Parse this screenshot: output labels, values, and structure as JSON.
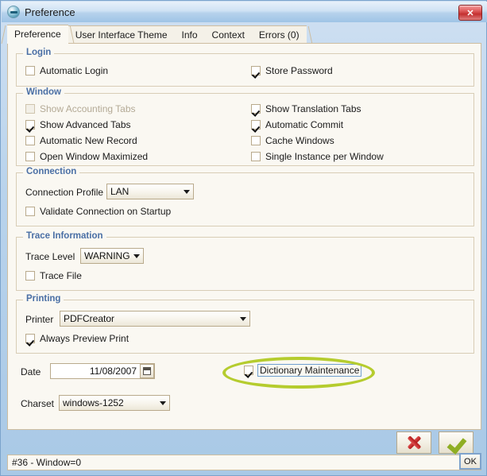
{
  "window": {
    "title": "Preference",
    "icon": "preference-icon",
    "close_label": "✕"
  },
  "tabs": [
    {
      "label": "Preference",
      "active": true
    },
    {
      "label": "User Interface Theme",
      "active": false
    },
    {
      "label": "Info",
      "active": false
    },
    {
      "label": "Context",
      "active": false
    },
    {
      "label": "Errors (0)",
      "active": false
    }
  ],
  "groups": {
    "login": {
      "title": "Login",
      "checkboxes": [
        {
          "label": "Automatic Login",
          "checked": false,
          "disabled": false
        },
        {
          "label": "Store Password",
          "checked": true,
          "disabled": false
        }
      ]
    },
    "window_group": {
      "title": "Window",
      "checkboxes": [
        {
          "label": "Show Accounting Tabs",
          "checked": false,
          "disabled": true
        },
        {
          "label": "Show Translation Tabs",
          "checked": true,
          "disabled": false
        },
        {
          "label": "Show Advanced Tabs",
          "checked": true,
          "disabled": false
        },
        {
          "label": "Automatic Commit",
          "checked": true,
          "disabled": false
        },
        {
          "label": "Automatic New Record",
          "checked": false,
          "disabled": false
        },
        {
          "label": "Cache Windows",
          "checked": false,
          "disabled": false
        },
        {
          "label": "Open Window Maximized",
          "checked": false,
          "disabled": false
        },
        {
          "label": "Single Instance per Window",
          "checked": false,
          "disabled": false
        }
      ]
    },
    "connection": {
      "title": "Connection",
      "profile_label": "Connection Profile",
      "profile_value": "LAN",
      "validate_label": "Validate Connection on Startup",
      "validate_checked": false
    },
    "trace": {
      "title": "Trace Information",
      "level_label": "Trace Level",
      "level_value": "WARNING",
      "file_label": "Trace File",
      "file_checked": false
    },
    "printing": {
      "title": "Printing",
      "printer_label": "Printer",
      "printer_value": "PDFCreator",
      "preview_label": "Always Preview Print",
      "preview_checked": true
    }
  },
  "bottom_fields": {
    "date_label": "Date",
    "date_value": "11/08/2007",
    "charset_label": "Charset",
    "charset_value": "windows-1252",
    "dictionary_label": "Dictionary Maintenance",
    "dictionary_checked": true
  },
  "buttons": {
    "cancel": "cancel-button",
    "ok": "ok-button"
  },
  "statusbar": {
    "text": "#36 - Window=0",
    "indicator": "OK"
  },
  "colors": {
    "group_title": "#4a6fa5",
    "annotation": "#b5cc2e",
    "panel_bg": "#faf8f2",
    "border": "#cdbda0"
  }
}
